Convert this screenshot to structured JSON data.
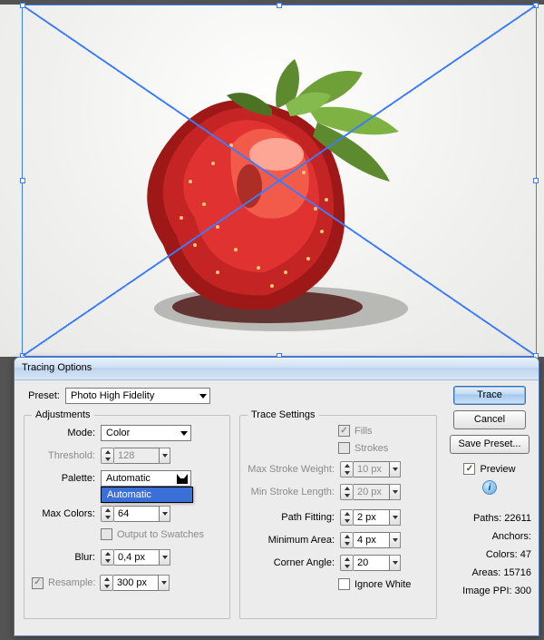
{
  "dialog": {
    "title": "Tracing Options",
    "preset_label": "Preset:",
    "preset_value": "Photo High Fidelity",
    "adjustments": {
      "legend": "Adjustments",
      "mode_label": "Mode:",
      "mode_value": "Color",
      "threshold_label": "Threshold:",
      "threshold_value": "128",
      "palette_label": "Palette:",
      "palette_value": "Automatic",
      "palette_popup_item": "Automatic",
      "maxcolors_label": "Max Colors:",
      "maxcolors_value": "64",
      "output_swatches_label": "Output to Swatches",
      "blur_label": "Blur:",
      "blur_value": "0,4 px",
      "resample_label": "Resample:",
      "resample_value": "300 px"
    },
    "trace_settings": {
      "legend": "Trace Settings",
      "fills_label": "Fills",
      "strokes_label": "Strokes",
      "max_stroke_weight_label": "Max Stroke Weight:",
      "max_stroke_weight_value": "10 px",
      "min_stroke_length_label": "Min Stroke Length:",
      "min_stroke_length_value": "20 px",
      "path_fitting_label": "Path Fitting:",
      "path_fitting_value": "2 px",
      "min_area_label": "Minimum Area:",
      "min_area_value": "4 px",
      "corner_angle_label": "Corner Angle:",
      "corner_angle_value": "20",
      "ignore_white_label": "Ignore White"
    },
    "buttons": {
      "trace": "Trace",
      "cancel": "Cancel",
      "save_preset": "Save Preset..."
    },
    "preview_label": "Preview",
    "stats": {
      "paths_label": "Paths:",
      "paths_value": "22611",
      "anchors_label": "Anchors:",
      "colors_label": "Colors:",
      "colors_value": "47",
      "areas_label": "Areas:",
      "areas_value": "15716",
      "ppi_label": "Image PPI:",
      "ppi_value": "300"
    }
  }
}
